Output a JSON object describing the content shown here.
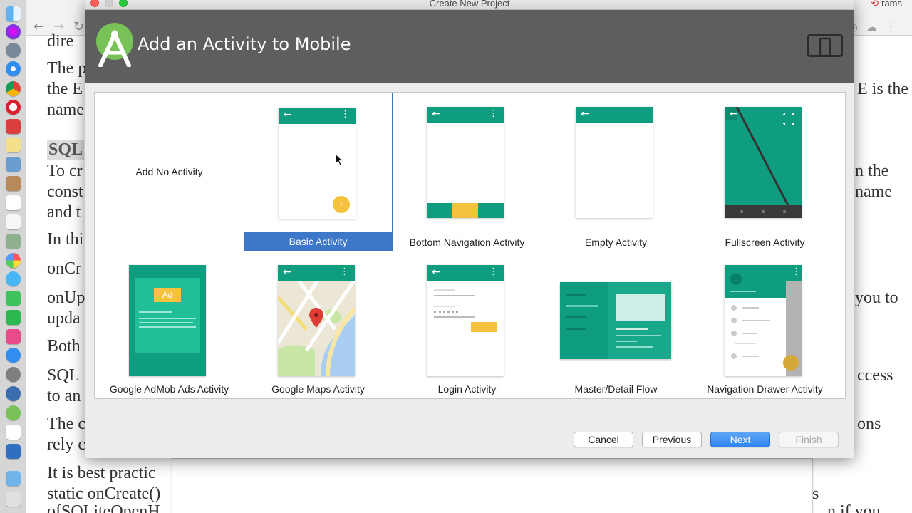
{
  "window": {
    "title": "Create New Project"
  },
  "header": {
    "title": "Add an Activity to Mobile"
  },
  "browser": {
    "user": "rams",
    "visible_text": [
      "dire",
      "The p",
      "the E",
      "name",
      "E is the",
      "SQL",
      "To cr",
      "n the",
      "const",
      "name",
      "and t",
      "In thi",
      "onCr",
      "onUp",
      "you to",
      "upda",
      "Both",
      "SQL",
      "ccess",
      "to an",
      "The c",
      "ons",
      "rely c",
      "It is best practic",
      "static onCreate()",
      "s",
      "ofSQLiteOpenH",
      "n if you"
    ]
  },
  "activities": [
    {
      "label": "Add No Activity",
      "selected": false
    },
    {
      "label": "Basic Activity",
      "selected": true
    },
    {
      "label": "Bottom Navigation Activity",
      "selected": false
    },
    {
      "label": "Empty Activity",
      "selected": false
    },
    {
      "label": "Fullscreen Activity",
      "selected": false
    },
    {
      "label": "Google AdMob Ads Activity",
      "selected": false
    },
    {
      "label": "Google Maps Activity",
      "selected": false
    },
    {
      "label": "Login Activity",
      "selected": false
    },
    {
      "label": "Master/Detail Flow",
      "selected": false
    },
    {
      "label": "Navigation Drawer Activity",
      "selected": false
    }
  ],
  "thumb_text": {
    "ad_badge": "Ad"
  },
  "buttons": {
    "cancel": "Cancel",
    "previous": "Previous",
    "next": "Next",
    "finish": "Finish"
  },
  "colors": {
    "accent_green": "#0f9d7f",
    "selection_blue": "#3d78c8",
    "fab_yellow": "#f4c23f",
    "header_gray": "#5e5e5e"
  },
  "icons": [
    "studio-logo-icon",
    "device-form-factor-icon",
    "back-arrow-icon",
    "overflow-menu-icon",
    "fullscreen-icon",
    "map-pin-icon",
    "mouse-cursor-icon"
  ]
}
